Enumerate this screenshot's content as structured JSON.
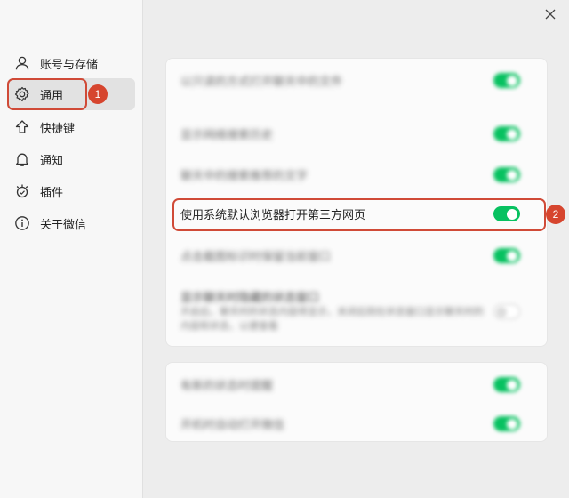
{
  "sidebar": {
    "items": [
      {
        "label": "账号与存储",
        "icon": "user-icon"
      },
      {
        "label": "通用",
        "icon": "gear-icon",
        "active": true
      },
      {
        "label": "快捷键",
        "icon": "shortcut-arrow-icon"
      },
      {
        "label": "通知",
        "icon": "bell-icon"
      },
      {
        "label": "插件",
        "icon": "plugin-icon"
      },
      {
        "label": "关于微信",
        "icon": "info-icon"
      }
    ]
  },
  "window": {
    "close_icon": "close-icon"
  },
  "settings": {
    "card1": [
      {
        "label": "以只读的方式打开聊天中的文件",
        "blurred": true,
        "on": true
      },
      {
        "label": "显示网络搜索历史",
        "blurred": true,
        "on": true
      },
      {
        "label": "聊天中的搜索推荐的文字",
        "blurred": true,
        "on": true
      },
      {
        "label": "使用系统默认浏览器打开第三方网页",
        "blurred": false,
        "on": true
      },
      {
        "label": "点击截图标识时保留当前窗口",
        "blurred": true,
        "on": true
      },
      {
        "label": "显示聊天时隐藏的状态窗口",
        "sub": "开启后，聊天时的状态内容将显示，关闭后则在状态窗口显示聊天时的内容和状态，以便查看",
        "blurred": true,
        "on": false
      }
    ],
    "card2": [
      {
        "label": "有新的状态时提醒",
        "blurred": true,
        "on": true
      },
      {
        "label": "开机时自动打开微信",
        "blurred": true,
        "on": true
      }
    ]
  },
  "annotations": {
    "badge1": "1",
    "badge2": "2",
    "color": "#d04a37"
  },
  "colors": {
    "toggle_on": "#07c160"
  }
}
